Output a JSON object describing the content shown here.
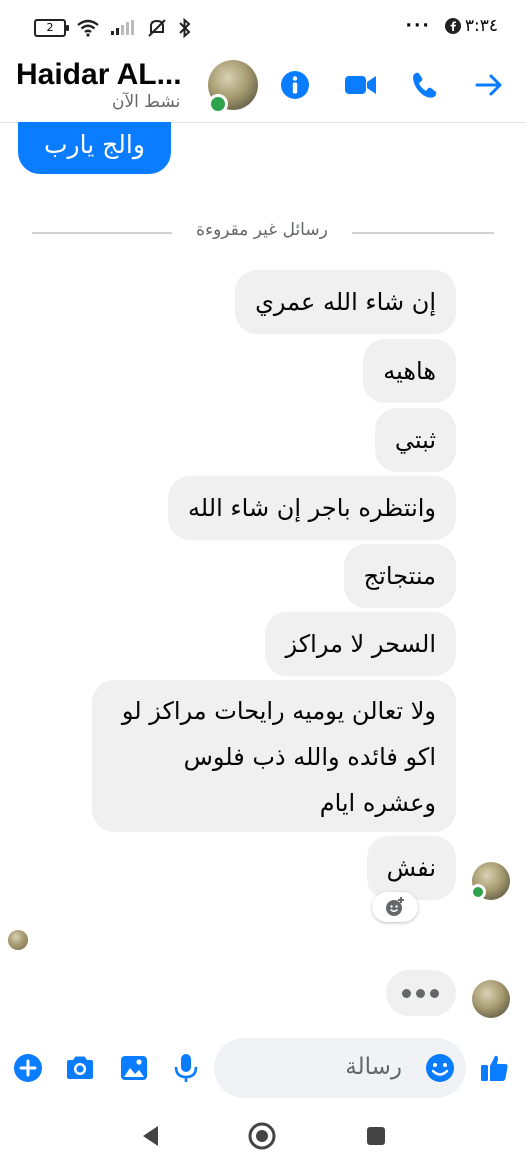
{
  "status_bar": {
    "battery_text": "2",
    "time": "٣:٣٤",
    "icons": [
      "battery-icon",
      "wifi-icon",
      "signal-icon",
      "mute-icon",
      "bluetooth-icon",
      "more-dots-icon",
      "facebook-icon"
    ]
  },
  "header": {
    "contact_name": "Haidar AL...",
    "status": "نشط الآن",
    "icons": [
      "info-icon",
      "video-call-icon",
      "phone-icon",
      "forward-arrow-icon"
    ]
  },
  "thread": {
    "sent_message": "والج يارب",
    "unread_divider": "رسائل غير مقروءة",
    "messages": [
      "إن شاء الله عمري",
      "هاهيه",
      "ثبتي",
      "وانتظره باجر إن شاء الله",
      "منتجاتج",
      "السحر لا مراكز",
      "ولا تعالن يوميه رايحات مراكز لو اكو فائده والله ذب فلوس وعشره ايام",
      "نفش"
    ]
  },
  "composer": {
    "placeholder": "رسالة",
    "icons": [
      "plus-icon",
      "camera-icon",
      "gallery-icon",
      "mic-icon",
      "emoji-icon",
      "like-icon"
    ]
  },
  "nav": {
    "icons": [
      "back-nav-icon",
      "home-nav-icon",
      "recents-nav-icon"
    ]
  },
  "colors": {
    "accent": "#0a7cff",
    "bubble_gray": "#f0f0f0",
    "online": "#31a24c"
  }
}
